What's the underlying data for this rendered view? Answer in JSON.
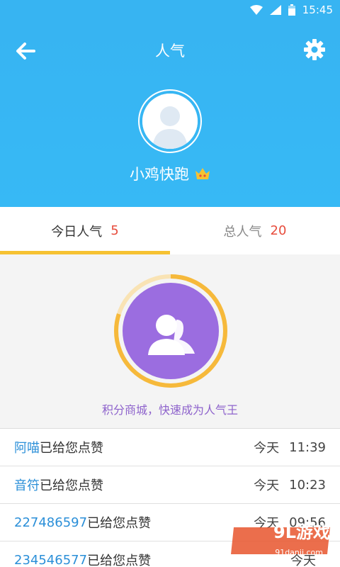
{
  "status_bar": {
    "time": "15:45",
    "icons": [
      "wifi-icon",
      "signal-icon",
      "battery-icon"
    ]
  },
  "header": {
    "title": "人气",
    "back_icon": "back-arrow-icon",
    "settings_icon": "gear-icon"
  },
  "profile": {
    "username": "小鸡快跑",
    "badge_icon": "crown-icon"
  },
  "tabs": [
    {
      "label": "今日人气",
      "count": "5",
      "active": true
    },
    {
      "label": "总人气",
      "count": "20",
      "active": false
    }
  ],
  "progress_ring": {
    "progress": 0.8,
    "icon": "people-icon"
  },
  "promo_text": "积分商城，快速成为人气王",
  "likes": [
    {
      "name": "阿喵",
      "action": "已给您点赞",
      "day": "今天",
      "time": "11:39"
    },
    {
      "name": "音符",
      "action": "已给您点赞",
      "day": "今天",
      "time": "10:23"
    },
    {
      "name": "227486597",
      "action": "已给您点赞",
      "day": "今天",
      "time": "09:56"
    },
    {
      "name": "234546577",
      "action": "已给您点赞",
      "day": "今天",
      "time": ""
    }
  ],
  "watermark": {
    "text": "9L游戏",
    "sub": "91danji.com"
  },
  "colors": {
    "header": "#37b4f2",
    "accent_yellow": "#f6c232",
    "purple": "#9b6de0",
    "count_red": "#e74c3c",
    "name_blue": "#2b8fd8"
  }
}
